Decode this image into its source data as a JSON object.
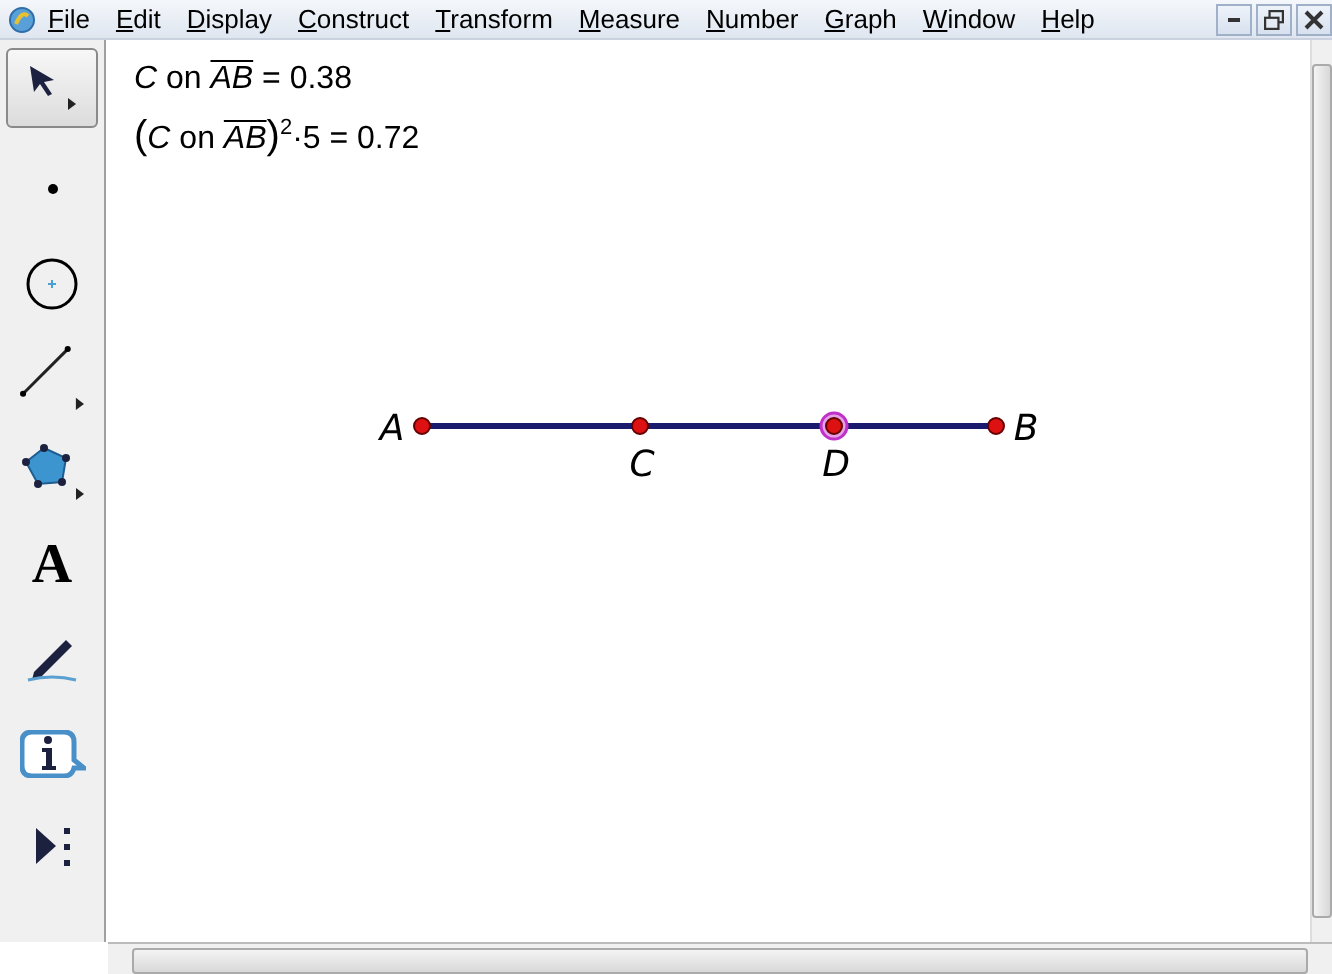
{
  "menu": [
    {
      "label": "File"
    },
    {
      "label": "Edit"
    },
    {
      "label": "Display"
    },
    {
      "label": "Construct"
    },
    {
      "label": "Transform"
    },
    {
      "label": "Measure"
    },
    {
      "label": "Number"
    },
    {
      "label": "Graph"
    },
    {
      "label": "Window"
    },
    {
      "label": "Help"
    }
  ],
  "tools": [
    {
      "kind": "arrow",
      "selected": true
    },
    {
      "kind": "point",
      "selected": false
    },
    {
      "kind": "compass",
      "selected": false
    },
    {
      "kind": "line",
      "selected": false
    },
    {
      "kind": "polygon",
      "selected": false
    },
    {
      "kind": "text",
      "glyph": "A",
      "selected": false
    },
    {
      "kind": "marker",
      "selected": false
    },
    {
      "kind": "info",
      "selected": false
    },
    {
      "kind": "custom",
      "selected": false
    }
  ],
  "measurements": [
    {
      "parts": [
        {
          "kind": "italic",
          "text": "C"
        },
        {
          "kind": "plain",
          "text": " on "
        },
        {
          "kind": "overline",
          "text": "AB"
        },
        {
          "kind": "plain",
          "text": " = 0.38"
        }
      ]
    },
    {
      "parts": [
        {
          "kind": "bracket",
          "text": "("
        },
        {
          "kind": "italic",
          "text": "C"
        },
        {
          "kind": "plain",
          "text": " on "
        },
        {
          "kind": "overline",
          "text": "AB"
        },
        {
          "kind": "bracket",
          "text": ")"
        },
        {
          "kind": "sup",
          "text": "2"
        },
        {
          "kind": "plain",
          "text": "·5 = 0.72"
        }
      ]
    }
  ],
  "points": [
    {
      "label": "A",
      "selected": false
    },
    {
      "label": "C",
      "selected": false
    },
    {
      "label": "D",
      "selected": true
    },
    {
      "label": "B",
      "selected": false
    }
  ]
}
